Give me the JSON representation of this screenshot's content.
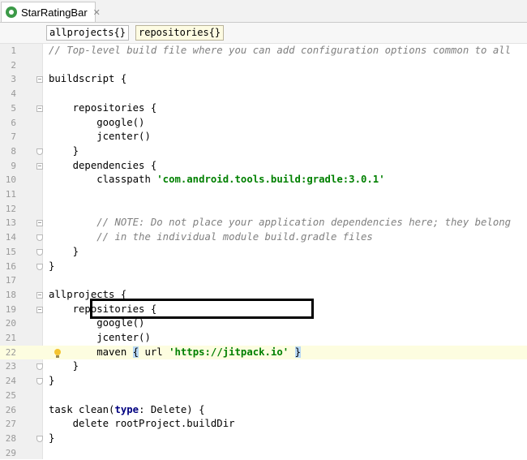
{
  "tab": {
    "title": "StarRatingBar",
    "close_glyph": "✕",
    "icon": "gradle-icon"
  },
  "breadcrumb": [
    "allprojects{}",
    "repositories{}"
  ],
  "editor": {
    "lines": [
      {
        "n": "1",
        "html": "<span class=\"cm\">// Top-level build file where you can add configuration options common to all</span>"
      },
      {
        "n": "2",
        "html": ""
      },
      {
        "n": "3",
        "html": "buildscript {"
      },
      {
        "n": "4",
        "html": ""
      },
      {
        "n": "5",
        "html": "    repositories {"
      },
      {
        "n": "6",
        "html": "        google()"
      },
      {
        "n": "7",
        "html": "        jcenter()"
      },
      {
        "n": "8",
        "html": "    }"
      },
      {
        "n": "9",
        "html": "    dependencies {"
      },
      {
        "n": "10",
        "html": "        classpath <span class=\"str\">'com.android.tools.build:gradle:3.0.1'</span>"
      },
      {
        "n": "11",
        "html": ""
      },
      {
        "n": "12",
        "html": ""
      },
      {
        "n": "13",
        "html": "        <span class=\"cm\">// NOTE: Do not place your application dependencies here; they belong</span>"
      },
      {
        "n": "14",
        "html": "        <span class=\"cm\">// in the individual module build.gradle files</span>"
      },
      {
        "n": "15",
        "html": "    }"
      },
      {
        "n": "16",
        "html": "}"
      },
      {
        "n": "17",
        "html": ""
      },
      {
        "n": "18",
        "html": "allprojects {"
      },
      {
        "n": "19",
        "html": "    repositories {"
      },
      {
        "n": "20",
        "html": "        google()"
      },
      {
        "n": "21",
        "html": "        jcenter()"
      },
      {
        "n": "22",
        "html": "        maven <span class=\"brace-hl\">{</span> url <span class=\"str\">'https://jitpack.io'</span> <span class=\"brace-hl\">}</span>"
      },
      {
        "n": "23",
        "html": "    }"
      },
      {
        "n": "24",
        "html": "}"
      },
      {
        "n": "25",
        "html": ""
      },
      {
        "n": "26",
        "html": "task clean(<span class=\"kw\">type</span>: Delete) {"
      },
      {
        "n": "27",
        "html": "    delete rootProject.buildDir"
      },
      {
        "n": "28",
        "html": "}"
      },
      {
        "n": "29",
        "html": ""
      }
    ],
    "caret_line": "22",
    "fold_open_lines": [
      "3",
      "5",
      "9",
      "13",
      "18",
      "19"
    ],
    "fold_close_lines": [
      "8",
      "14",
      "15",
      "16",
      "23",
      "24",
      "28"
    ]
  }
}
